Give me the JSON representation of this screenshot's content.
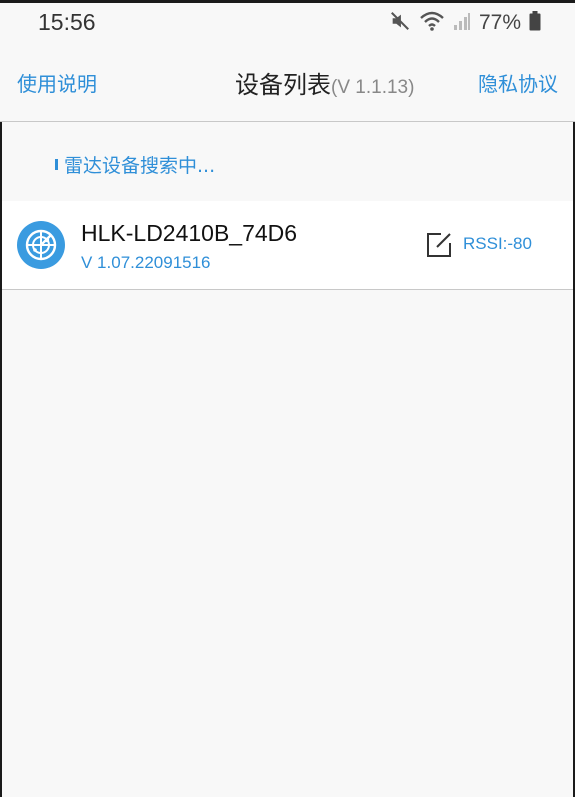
{
  "status_bar": {
    "time": "15:56",
    "battery": "77%",
    "icons": [
      "mute-icon",
      "wifi-icon",
      "signal-icon",
      "battery-icon"
    ]
  },
  "header": {
    "left_link": "使用说明",
    "title": "设备列表",
    "version": "(V 1.1.13)",
    "right_link": "隐私协议"
  },
  "search_status": "雷达设备搜索中...",
  "devices": [
    {
      "name": "HLK-LD2410B_74D6",
      "version": "V 1.07.22091516",
      "rssi": "RSSI:-80",
      "icon": "radar-icon"
    }
  ],
  "colors": {
    "accent": "#2f8fd8",
    "background": "#f8f8f8",
    "row_background": "#ffffff",
    "divider": "#c8c8c8"
  }
}
